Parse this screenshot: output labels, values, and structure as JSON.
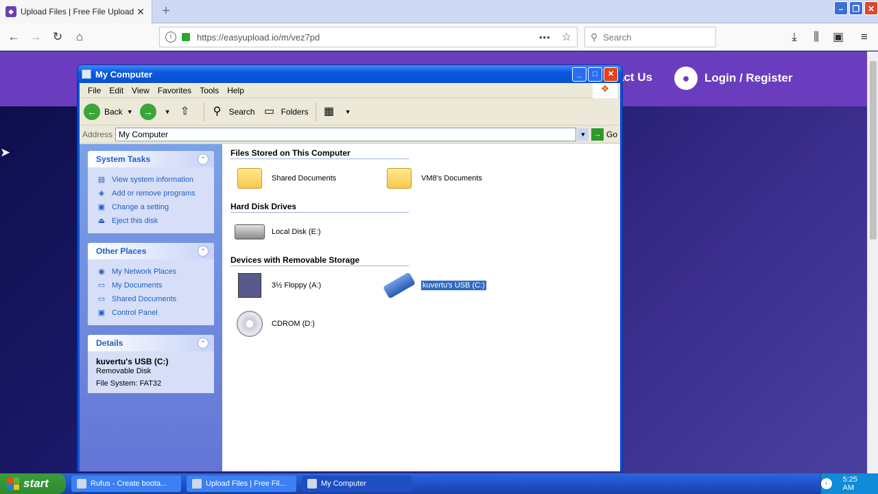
{
  "browser": {
    "tab_title": "Upload Files | Free File Upload an",
    "tab_close": "✕",
    "newtab": "+",
    "url": "https://easyupload.io/m/vez7pd",
    "search_placeholder": "Search"
  },
  "site": {
    "contact": "act Us",
    "login": "Login / Register"
  },
  "window": {
    "title": "My Computer",
    "menu": [
      "File",
      "Edit",
      "View",
      "Favorites",
      "Tools",
      "Help"
    ],
    "toolbar": {
      "back": "Back",
      "search": "Search",
      "folders": "Folders"
    },
    "address_label": "Address",
    "address_value": "My Computer",
    "go": "Go"
  },
  "taskpane": {
    "system_tasks": {
      "title": "System Tasks",
      "items": [
        "View system information",
        "Add or remove programs",
        "Change a setting",
        "Eject this disk"
      ]
    },
    "other_places": {
      "title": "Other Places",
      "items": [
        "My Network Places",
        "My Documents",
        "Shared Documents",
        "Control Panel"
      ]
    },
    "details": {
      "title": "Details",
      "name": "kuvertu's USB (C:)",
      "type": "Removable Disk",
      "fs": "File System: FAT32"
    }
  },
  "content": {
    "sections": [
      {
        "title": "Files Stored on This Computer",
        "items": [
          "Shared Documents",
          "VM8's Documents"
        ]
      },
      {
        "title": "Hard Disk Drives",
        "items": [
          "Local Disk (E:)"
        ]
      },
      {
        "title": "Devices with Removable Storage",
        "items": [
          "3½ Floppy (A:)",
          "kuvertu's USB (C:)",
          "CDROM (D:)"
        ]
      }
    ]
  },
  "taskbar": {
    "start": "start",
    "tasks": [
      "Rufus - Create boota...",
      "Upload Files | Free Fil...",
      "My Computer"
    ],
    "clock": "5:25 AM"
  }
}
